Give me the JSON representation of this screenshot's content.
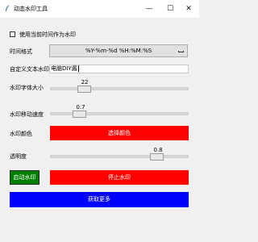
{
  "window": {
    "title": "动态水印工具",
    "minimize": "—",
    "maximize": "☐",
    "close": "✕"
  },
  "checkbox": {
    "label": "使用当前时间作为水印",
    "checked": false
  },
  "time_format": {
    "label": "时间格式",
    "value": "%Y-%m-%d %H:%M:%S"
  },
  "custom_text": {
    "label": "自定义文本水印",
    "value": "电脑DIY酱"
  },
  "font_size": {
    "label": "水印字体大小",
    "value": "22",
    "level": 0.22
  },
  "move_speed": {
    "label": "水印移动速度",
    "value": "0.7",
    "level": 0.18
  },
  "color": {
    "label": "水印颜色",
    "button_label": "选择颜色",
    "value": "#ff0000"
  },
  "opacity": {
    "label": "透明度",
    "value": "0.8",
    "level": 0.8
  },
  "actions": {
    "start_label": "启动水印",
    "stop_label": "停止水印",
    "more_label": "获取更多"
  },
  "colors": {
    "start": "#007f00",
    "stop": "#ff0000",
    "more": "#0000ff"
  }
}
